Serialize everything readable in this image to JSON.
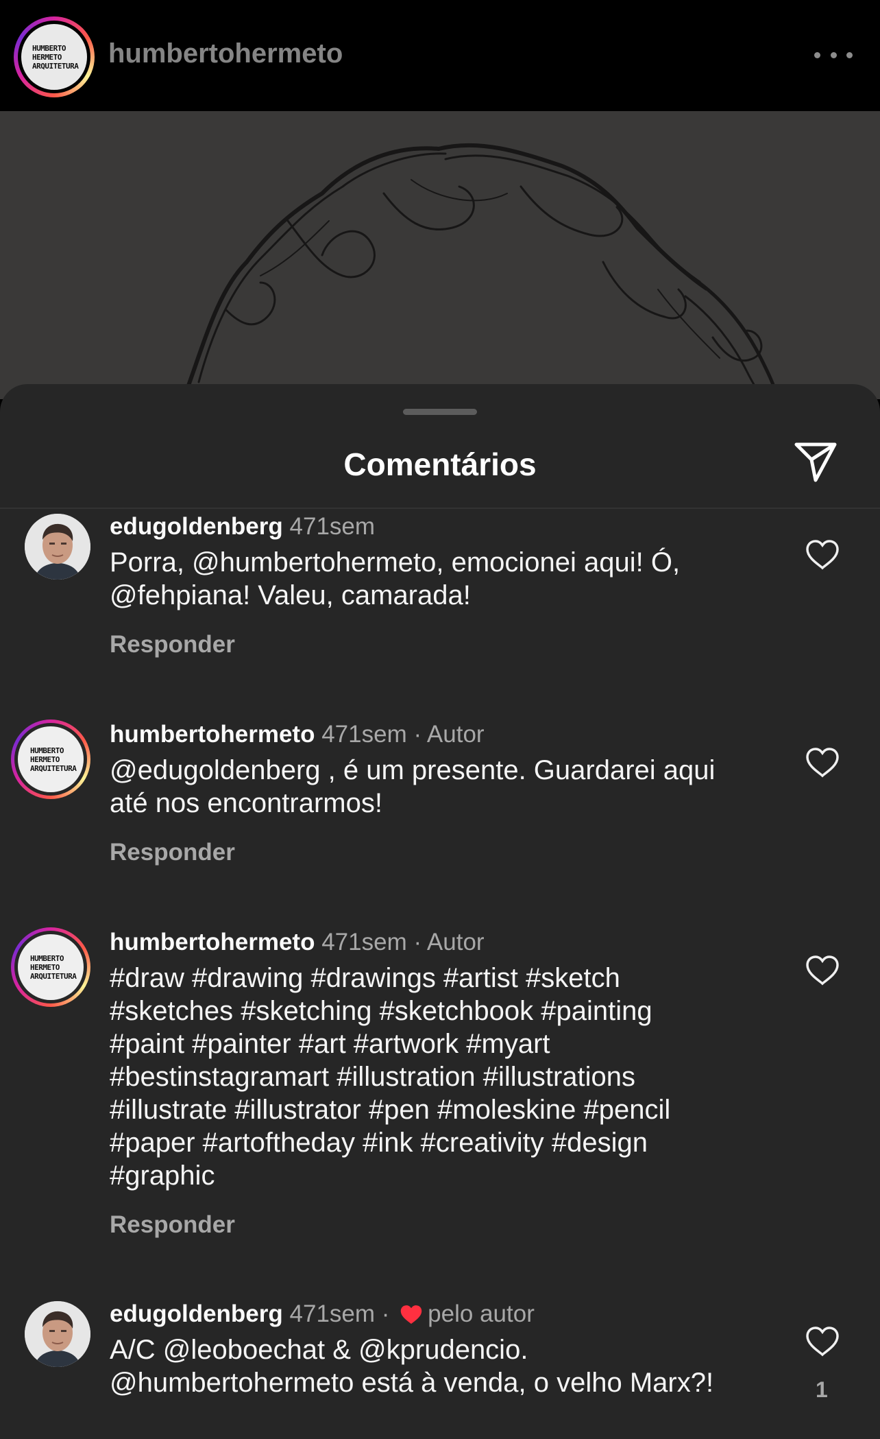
{
  "header": {
    "username": "humbertohermeto",
    "logo_lines": [
      "HUMBERTO",
      "HERMETO",
      "ARQUITETURA"
    ]
  },
  "sheet": {
    "title": "Comentários"
  },
  "comments": [
    {
      "user": "edugoldenberg",
      "time": "471sem",
      "text": "Porra, @humbertohermeto, emocionei aqui! Ó,\n@fehpiana! Valeu, camarada!",
      "reply": "Responder"
    },
    {
      "user": "humbertohermeto",
      "time": "471sem",
      "separator": "·",
      "tag": "Autor",
      "text": "@edugoldenberg , é um presente. Guardarei aqui\naté nos encontrarmos!",
      "reply": "Responder"
    },
    {
      "user": "humbertohermeto",
      "time": "471sem",
      "separator": "·",
      "tag": "Autor",
      "text": "#draw #drawing #drawings #artist #sketch\n#sketches #sketching #sketchbook #painting\n#paint #painter #art #artwork #myart\n#bestinstagramart #illustration #illustrations\n#illustrate #illustrator #pen #moleskine #pencil\n#paper #artoftheday #ink #creativity #design\n#graphic",
      "reply": "Responder"
    },
    {
      "user": "edugoldenberg",
      "time": "471sem",
      "separator": "·",
      "tag": "pelo autor",
      "text": "A/C @leoboechat & @kprudencio.\n@humbertohermeto está à venda, o velho Marx?!",
      "likes": "1"
    }
  ],
  "colors": {
    "background": "#262626",
    "muted_text": "#a8a8a8",
    "like_red": "#ff3040"
  }
}
